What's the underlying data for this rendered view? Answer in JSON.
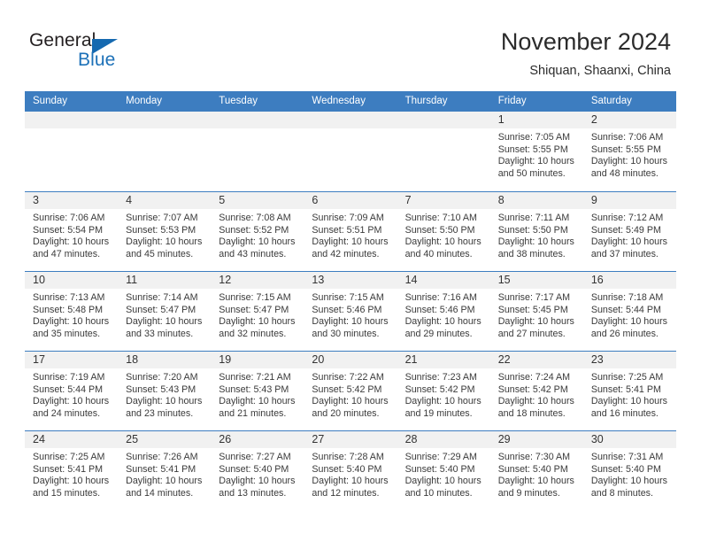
{
  "brand": {
    "word1": "General",
    "word2": "Blue",
    "primary_color": "#1569b0",
    "text_color": "#231f20"
  },
  "header": {
    "title": "November 2024",
    "subtitle": "Shiquan, Shaanxi, China",
    "header_bg_color": "#3d7dc0"
  },
  "calendar": {
    "weekday_headers": [
      "Sunday",
      "Monday",
      "Tuesday",
      "Wednesday",
      "Thursday",
      "Friday",
      "Saturday"
    ],
    "weeks": [
      [
        {
          "day": "",
          "sunrise": "",
          "sunset": "",
          "daylight_line1": "",
          "daylight_line2": ""
        },
        {
          "day": "",
          "sunrise": "",
          "sunset": "",
          "daylight_line1": "",
          "daylight_line2": ""
        },
        {
          "day": "",
          "sunrise": "",
          "sunset": "",
          "daylight_line1": "",
          "daylight_line2": ""
        },
        {
          "day": "",
          "sunrise": "",
          "sunset": "",
          "daylight_line1": "",
          "daylight_line2": ""
        },
        {
          "day": "",
          "sunrise": "",
          "sunset": "",
          "daylight_line1": "",
          "daylight_line2": ""
        },
        {
          "day": "1",
          "sunrise": "Sunrise: 7:05 AM",
          "sunset": "Sunset: 5:55 PM",
          "daylight_line1": "Daylight: 10 hours",
          "daylight_line2": "and 50 minutes."
        },
        {
          "day": "2",
          "sunrise": "Sunrise: 7:06 AM",
          "sunset": "Sunset: 5:55 PM",
          "daylight_line1": "Daylight: 10 hours",
          "daylight_line2": "and 48 minutes."
        }
      ],
      [
        {
          "day": "3",
          "sunrise": "Sunrise: 7:06 AM",
          "sunset": "Sunset: 5:54 PM",
          "daylight_line1": "Daylight: 10 hours",
          "daylight_line2": "and 47 minutes."
        },
        {
          "day": "4",
          "sunrise": "Sunrise: 7:07 AM",
          "sunset": "Sunset: 5:53 PM",
          "daylight_line1": "Daylight: 10 hours",
          "daylight_line2": "and 45 minutes."
        },
        {
          "day": "5",
          "sunrise": "Sunrise: 7:08 AM",
          "sunset": "Sunset: 5:52 PM",
          "daylight_line1": "Daylight: 10 hours",
          "daylight_line2": "and 43 minutes."
        },
        {
          "day": "6",
          "sunrise": "Sunrise: 7:09 AM",
          "sunset": "Sunset: 5:51 PM",
          "daylight_line1": "Daylight: 10 hours",
          "daylight_line2": "and 42 minutes."
        },
        {
          "day": "7",
          "sunrise": "Sunrise: 7:10 AM",
          "sunset": "Sunset: 5:50 PM",
          "daylight_line1": "Daylight: 10 hours",
          "daylight_line2": "and 40 minutes."
        },
        {
          "day": "8",
          "sunrise": "Sunrise: 7:11 AM",
          "sunset": "Sunset: 5:50 PM",
          "daylight_line1": "Daylight: 10 hours",
          "daylight_line2": "and 38 minutes."
        },
        {
          "day": "9",
          "sunrise": "Sunrise: 7:12 AM",
          "sunset": "Sunset: 5:49 PM",
          "daylight_line1": "Daylight: 10 hours",
          "daylight_line2": "and 37 minutes."
        }
      ],
      [
        {
          "day": "10",
          "sunrise": "Sunrise: 7:13 AM",
          "sunset": "Sunset: 5:48 PM",
          "daylight_line1": "Daylight: 10 hours",
          "daylight_line2": "and 35 minutes."
        },
        {
          "day": "11",
          "sunrise": "Sunrise: 7:14 AM",
          "sunset": "Sunset: 5:47 PM",
          "daylight_line1": "Daylight: 10 hours",
          "daylight_line2": "and 33 minutes."
        },
        {
          "day": "12",
          "sunrise": "Sunrise: 7:15 AM",
          "sunset": "Sunset: 5:47 PM",
          "daylight_line1": "Daylight: 10 hours",
          "daylight_line2": "and 32 minutes."
        },
        {
          "day": "13",
          "sunrise": "Sunrise: 7:15 AM",
          "sunset": "Sunset: 5:46 PM",
          "daylight_line1": "Daylight: 10 hours",
          "daylight_line2": "and 30 minutes."
        },
        {
          "day": "14",
          "sunrise": "Sunrise: 7:16 AM",
          "sunset": "Sunset: 5:46 PM",
          "daylight_line1": "Daylight: 10 hours",
          "daylight_line2": "and 29 minutes."
        },
        {
          "day": "15",
          "sunrise": "Sunrise: 7:17 AM",
          "sunset": "Sunset: 5:45 PM",
          "daylight_line1": "Daylight: 10 hours",
          "daylight_line2": "and 27 minutes."
        },
        {
          "day": "16",
          "sunrise": "Sunrise: 7:18 AM",
          "sunset": "Sunset: 5:44 PM",
          "daylight_line1": "Daylight: 10 hours",
          "daylight_line2": "and 26 minutes."
        }
      ],
      [
        {
          "day": "17",
          "sunrise": "Sunrise: 7:19 AM",
          "sunset": "Sunset: 5:44 PM",
          "daylight_line1": "Daylight: 10 hours",
          "daylight_line2": "and 24 minutes."
        },
        {
          "day": "18",
          "sunrise": "Sunrise: 7:20 AM",
          "sunset": "Sunset: 5:43 PM",
          "daylight_line1": "Daylight: 10 hours",
          "daylight_line2": "and 23 minutes."
        },
        {
          "day": "19",
          "sunrise": "Sunrise: 7:21 AM",
          "sunset": "Sunset: 5:43 PM",
          "daylight_line1": "Daylight: 10 hours",
          "daylight_line2": "and 21 minutes."
        },
        {
          "day": "20",
          "sunrise": "Sunrise: 7:22 AM",
          "sunset": "Sunset: 5:42 PM",
          "daylight_line1": "Daylight: 10 hours",
          "daylight_line2": "and 20 minutes."
        },
        {
          "day": "21",
          "sunrise": "Sunrise: 7:23 AM",
          "sunset": "Sunset: 5:42 PM",
          "daylight_line1": "Daylight: 10 hours",
          "daylight_line2": "and 19 minutes."
        },
        {
          "day": "22",
          "sunrise": "Sunrise: 7:24 AM",
          "sunset": "Sunset: 5:42 PM",
          "daylight_line1": "Daylight: 10 hours",
          "daylight_line2": "and 18 minutes."
        },
        {
          "day": "23",
          "sunrise": "Sunrise: 7:25 AM",
          "sunset": "Sunset: 5:41 PM",
          "daylight_line1": "Daylight: 10 hours",
          "daylight_line2": "and 16 minutes."
        }
      ],
      [
        {
          "day": "24",
          "sunrise": "Sunrise: 7:25 AM",
          "sunset": "Sunset: 5:41 PM",
          "daylight_line1": "Daylight: 10 hours",
          "daylight_line2": "and 15 minutes."
        },
        {
          "day": "25",
          "sunrise": "Sunrise: 7:26 AM",
          "sunset": "Sunset: 5:41 PM",
          "daylight_line1": "Daylight: 10 hours",
          "daylight_line2": "and 14 minutes."
        },
        {
          "day": "26",
          "sunrise": "Sunrise: 7:27 AM",
          "sunset": "Sunset: 5:40 PM",
          "daylight_line1": "Daylight: 10 hours",
          "daylight_line2": "and 13 minutes."
        },
        {
          "day": "27",
          "sunrise": "Sunrise: 7:28 AM",
          "sunset": "Sunset: 5:40 PM",
          "daylight_line1": "Daylight: 10 hours",
          "daylight_line2": "and 12 minutes."
        },
        {
          "day": "28",
          "sunrise": "Sunrise: 7:29 AM",
          "sunset": "Sunset: 5:40 PM",
          "daylight_line1": "Daylight: 10 hours",
          "daylight_line2": "and 10 minutes."
        },
        {
          "day": "29",
          "sunrise": "Sunrise: 7:30 AM",
          "sunset": "Sunset: 5:40 PM",
          "daylight_line1": "Daylight: 10 hours",
          "daylight_line2": "and 9 minutes."
        },
        {
          "day": "30",
          "sunrise": "Sunrise: 7:31 AM",
          "sunset": "Sunset: 5:40 PM",
          "daylight_line1": "Daylight: 10 hours",
          "daylight_line2": "and 8 minutes."
        }
      ]
    ]
  }
}
